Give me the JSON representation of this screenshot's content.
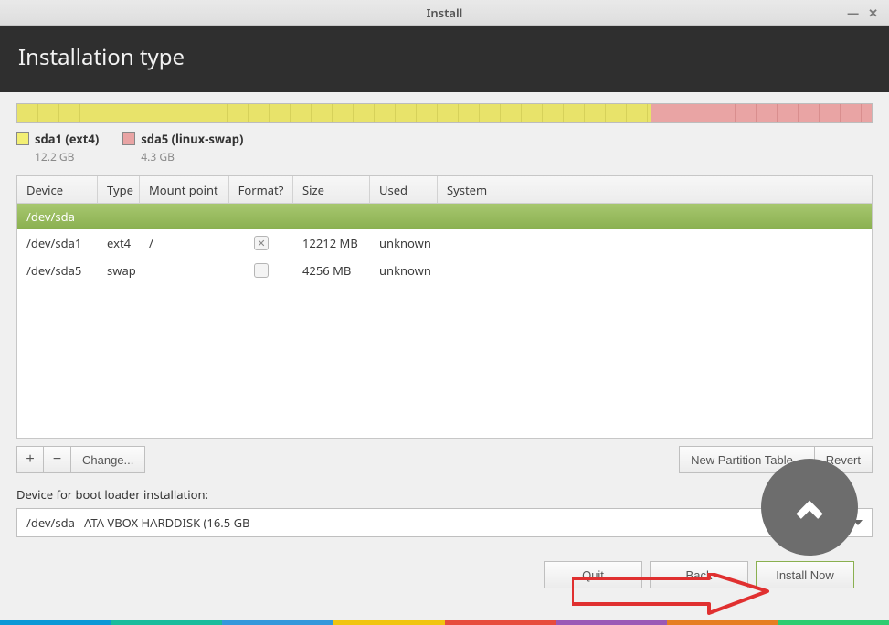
{
  "window": {
    "title": "Install"
  },
  "header": {
    "title": "Installation type"
  },
  "partitions": {
    "segments": [
      {
        "percent": 74.2
      },
      {
        "percent": 25.8
      }
    ],
    "legend": [
      {
        "label": "sda1 (ext4)",
        "size": "12.2 GB"
      },
      {
        "label": "sda5 (linux-swap)",
        "size": "4.3 GB"
      }
    ]
  },
  "table": {
    "columns": {
      "device": "Device",
      "type": "Type",
      "mount": "Mount point",
      "format": "Format?",
      "size": "Size",
      "used": "Used",
      "system": "System"
    },
    "disk_header": "/dev/sda",
    "rows": [
      {
        "device": "/dev/sda1",
        "type": "ext4",
        "mount": "/",
        "format_checked": true,
        "size": "12212 MB",
        "used": "unknown"
      },
      {
        "device": "/dev/sda5",
        "type": "swap",
        "mount": "",
        "format_checked": false,
        "size": "4256 MB",
        "used": "unknown"
      }
    ]
  },
  "toolbar": {
    "add": "+",
    "remove": "−",
    "change": "Change...",
    "new_table": "New Partition Table...",
    "revert": "Revert"
  },
  "bootloader": {
    "label": "Device for boot loader installation:",
    "value": "/dev/sda   ATA VBOX HARDDISK (16.5 GB"
  },
  "nav": {
    "quit": "Quit",
    "back": "Back",
    "install": "Install Now"
  }
}
